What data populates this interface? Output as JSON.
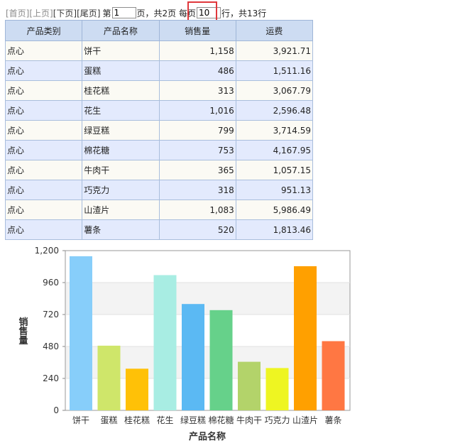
{
  "pager": {
    "first": "[首页]",
    "prev": "[上页]",
    "next": "[下页]",
    "last": "[尾页]",
    "page_prefix": "第",
    "page_value": "1",
    "page_suffix": "页，共2页 每页",
    "rows_value": "10",
    "rows_suffix": "行，共13行"
  },
  "table": {
    "headers": [
      "产品类别",
      "产品名称",
      "销售量",
      "运费"
    ],
    "rows": [
      [
        "点心",
        "饼干",
        "1,158",
        "3,921.71"
      ],
      [
        "点心",
        "蛋糕",
        "486",
        "1,511.16"
      ],
      [
        "点心",
        "桂花糕",
        "313",
        "3,067.79"
      ],
      [
        "点心",
        "花生",
        "1,016",
        "2,596.48"
      ],
      [
        "点心",
        "绿豆糕",
        "799",
        "3,714.59"
      ],
      [
        "点心",
        "棉花糖",
        "753",
        "4,167.95"
      ],
      [
        "点心",
        "牛肉干",
        "365",
        "1,057.15"
      ],
      [
        "点心",
        "巧克力",
        "318",
        "951.13"
      ],
      [
        "点心",
        "山渣片",
        "1,083",
        "5,986.49"
      ],
      [
        "点心",
        "薯条",
        "520",
        "1,813.46"
      ]
    ]
  },
  "chart_data": {
    "type": "bar",
    "categories": [
      "饼干",
      "蛋糕",
      "桂花糕",
      "花生",
      "绿豆糕",
      "棉花糖",
      "牛肉干",
      "巧克力",
      "山渣片",
      "薯条"
    ],
    "values": [
      1158,
      486,
      313,
      1016,
      799,
      753,
      365,
      318,
      1083,
      520
    ],
    "colors": [
      "#87cefa",
      "#cfe66a",
      "#ffc107",
      "#a8ede3",
      "#5bb9f3",
      "#66d18a",
      "#b3d36a",
      "#eef522",
      "#ffa000",
      "#ff7743"
    ],
    "title": "",
    "xlabel": "产品名称",
    "ylabel": "销售量",
    "ylim": [
      0,
      1200
    ],
    "yticks": [
      "0",
      "240",
      "480",
      "720",
      "960",
      "1,200"
    ],
    "grid": true,
    "legend": "none"
  }
}
